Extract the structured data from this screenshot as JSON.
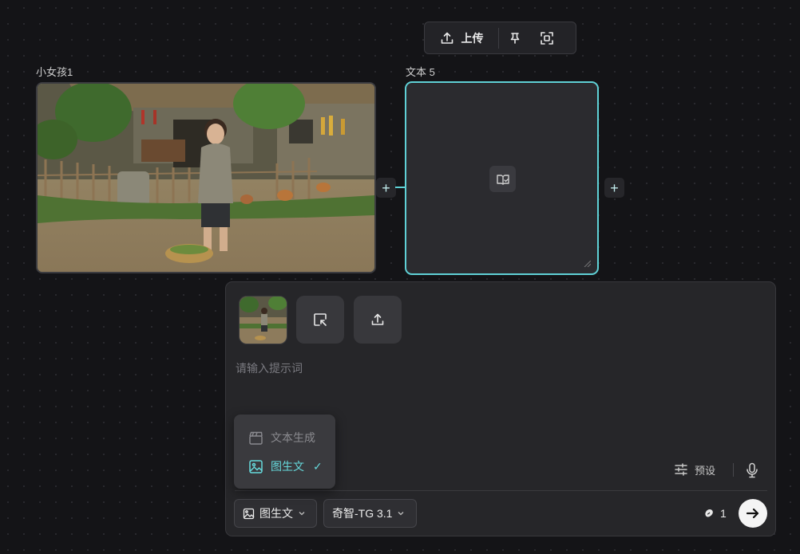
{
  "toolbar": {
    "upload_label": "上传",
    "upload_icon": "upload-icon",
    "pin_icon": "pin-icon",
    "focus_icon": "focus-frame-icon"
  },
  "canvas": {
    "image_node": {
      "label": "小女孩1"
    },
    "text_node": {
      "label": "文本 5",
      "icon": "book-check-icon"
    },
    "accent_color": "#5fd1d6"
  },
  "panel": {
    "prompt_placeholder": "请输入提示词",
    "select_icon": "select-node-icon",
    "upload_icon": "upload-icon",
    "preset_label": "预设",
    "mode_chip_label": "图生文",
    "model_chip_label": "奇智-TG 3.1",
    "credits": "1"
  },
  "mode_menu": {
    "items": [
      {
        "label": "文本生成",
        "icon": "clapperboard-icon",
        "state": "disabled"
      },
      {
        "label": "图生文",
        "icon": "image-icon",
        "state": "selected",
        "check": "✓"
      }
    ]
  }
}
